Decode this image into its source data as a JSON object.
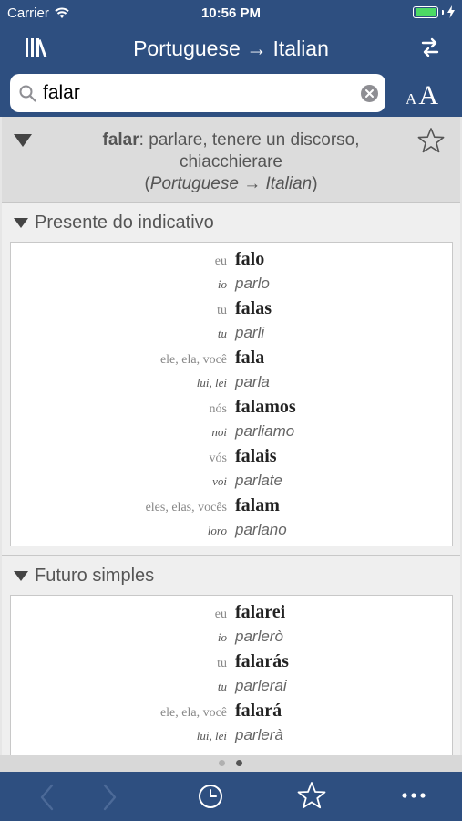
{
  "status": {
    "carrier": "Carrier",
    "time": "10:56 PM"
  },
  "nav": {
    "title": "Portuguese → Italian",
    "library_icon": "library-icon",
    "swap_icon": "swap-direction-icon"
  },
  "search": {
    "value": "falar",
    "font_small": "A",
    "font_large": "A"
  },
  "entry": {
    "headword": "falar",
    "translation": ": parlare, tenere un discorso, chiacchierare",
    "direction_open": "(",
    "direction_from": "Portuguese",
    "direction_arrow": " → ",
    "direction_to": "Italian",
    "direction_close": ")"
  },
  "sections": [
    {
      "title": "Presente do indicativo",
      "rows": [
        {
          "pt_pron": "eu",
          "pt_verb": "falo",
          "it_pron": "io",
          "it_verb": "parlo"
        },
        {
          "pt_pron": "tu",
          "pt_verb": "falas",
          "it_pron": "tu",
          "it_verb": "parli"
        },
        {
          "pt_pron": "ele, ela, você",
          "pt_verb": "fala",
          "it_pron": "lui, lei",
          "it_verb": "parla"
        },
        {
          "pt_pron": "nós",
          "pt_verb": "falamos",
          "it_pron": "noi",
          "it_verb": "parliamo"
        },
        {
          "pt_pron": "vós",
          "pt_verb": "falais",
          "it_pron": "voi",
          "it_verb": "parlate"
        },
        {
          "pt_pron": "eles, elas, vocês",
          "pt_verb": "falam",
          "it_pron": "loro",
          "it_verb": "parlano"
        }
      ]
    },
    {
      "title": "Futuro simples",
      "rows": [
        {
          "pt_pron": "eu",
          "pt_verb": "falarei",
          "it_pron": "io",
          "it_verb": "parlerò"
        },
        {
          "pt_pron": "tu",
          "pt_verb": "falarás",
          "it_pron": "tu",
          "it_verb": "parlerai"
        },
        {
          "pt_pron": "ele, ela, você",
          "pt_verb": "falará",
          "it_pron": "lui, lei",
          "it_verb": "parlerà"
        }
      ]
    }
  ],
  "pager": {
    "current_page": 2,
    "total_pages": 2
  },
  "toolbar": {
    "back_icon": "chevron-left-icon",
    "forward_icon": "chevron-right-icon",
    "history_icon": "clock-icon",
    "favorites_icon": "star-icon",
    "more_icon": "more-icon"
  },
  "colors": {
    "bar": "#2e4f80",
    "header": "#dcdcdc",
    "battery": "#4cd964"
  }
}
